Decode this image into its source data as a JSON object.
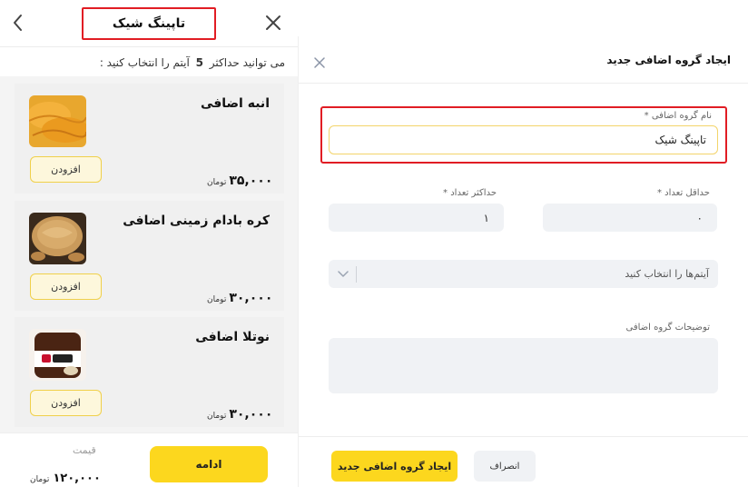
{
  "preview": {
    "title": "تاپینگ شیک",
    "hint": {
      "before": "می توانید حداکثر",
      "max": "5",
      "after": "آیتم را انتخاب کنید :"
    },
    "items": [
      {
        "name": "انبه اضافی",
        "price": "۳۵,۰۰۰",
        "currency": "تومان",
        "add_label": "افزودن",
        "image": "mango-slices"
      },
      {
        "name": "کره بادام زمینی اضافی",
        "price": "۳۰,۰۰۰",
        "currency": "تومان",
        "add_label": "افزودن",
        "image": "peanut-butter-bowl"
      },
      {
        "name": "نوتلا اضافی",
        "price": "۳۰,۰۰۰",
        "currency": "تومان",
        "add_label": "افزودن",
        "image": "nutella-jar"
      }
    ],
    "footer": {
      "continue_label": "ادامه",
      "total_label": "قیمت",
      "total_value": "۱۲۰,۰۰۰",
      "currency": "تومان"
    },
    "icons": {
      "back": "chevron-left-icon",
      "close": "close-icon"
    }
  },
  "modal": {
    "title": "ایجاد گروه اضافی جدید",
    "name_label": "نام گروه اضافی *",
    "name_value": "تاپینگ شیک",
    "min_label": "حداقل تعداد *",
    "min_value": "۰",
    "max_label": "حداکثر تعداد *",
    "max_value": "۱",
    "items_placeholder": "آیتم‌ها را انتخاب کنید",
    "description_label": "توضیحات گروه اضافی",
    "description_value": "",
    "create_label": "ایجاد گروه اضافی جدید",
    "cancel_label": "انصراف"
  },
  "colors": {
    "accent_yellow": "#fcd71e",
    "highlight_red": "#e11d24",
    "field_gray": "#f0f2f5"
  }
}
